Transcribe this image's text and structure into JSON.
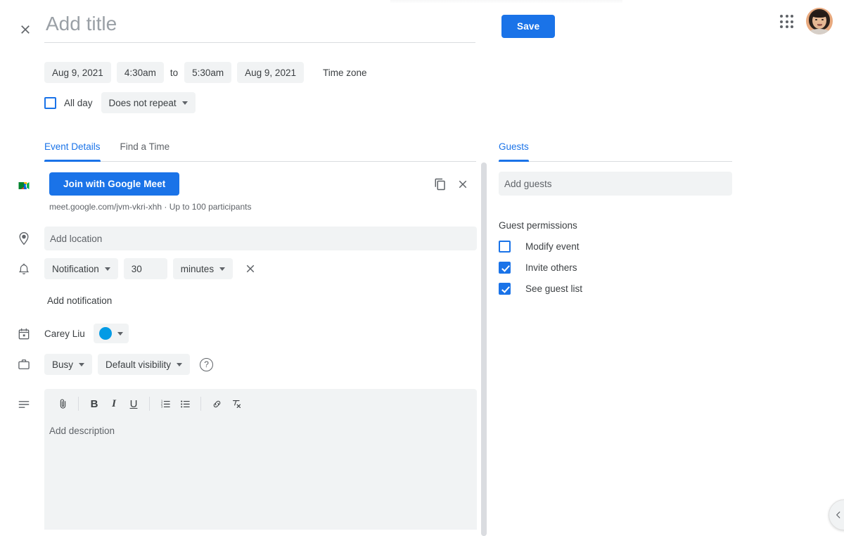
{
  "header": {
    "close_icon": "close-icon",
    "title_value": "",
    "title_placeholder": "Add title",
    "save_label": "Save",
    "apps_icon": "apps-grid-icon",
    "avatar_icon": "user-avatar"
  },
  "schedule": {
    "start_date": "Aug 9, 2021",
    "start_time": "4:30am",
    "to_label": "to",
    "end_time": "5:30am",
    "end_date": "Aug 9, 2021",
    "timezone_label": "Time zone",
    "all_day_label": "All day",
    "all_day_checked": false,
    "repeat_label": "Does not repeat"
  },
  "tabs": {
    "left": [
      {
        "label": "Event Details",
        "active": true
      },
      {
        "label": "Find a Time",
        "active": false
      }
    ],
    "right": [
      {
        "label": "Guests",
        "active": true
      }
    ]
  },
  "conference": {
    "icon": "google-meet-icon",
    "join_label": "Join with Google Meet",
    "details": "meet.google.com/jvm-vkri-xhh · Up to 100 participants",
    "copy_icon": "copy-icon",
    "remove_icon": "close-icon"
  },
  "location": {
    "icon": "location-pin-icon",
    "value": "",
    "placeholder": "Add location"
  },
  "notification": {
    "icon": "bell-icon",
    "type_label": "Notification",
    "amount_value": "30",
    "unit_label": "minutes",
    "remove_icon": "close-icon",
    "add_label": "Add notification"
  },
  "calendar": {
    "icon": "calendar-icon",
    "owner": "Carey Liu",
    "color_hex": "#039be5"
  },
  "availability": {
    "icon": "briefcase-icon",
    "busy_label": "Busy",
    "visibility_label": "Default visibility",
    "help_icon": "help-icon",
    "help_glyph": "?"
  },
  "description": {
    "icon": "description-lines-icon",
    "placeholder": "Add description",
    "toolbar": [
      {
        "name": "attach-icon",
        "label": ""
      },
      {
        "name": "bold-icon",
        "label": "B"
      },
      {
        "name": "italic-icon",
        "label": "I"
      },
      {
        "name": "underline-icon",
        "label": "U"
      },
      {
        "name": "numbered-list-icon",
        "label": ""
      },
      {
        "name": "bulleted-list-icon",
        "label": ""
      },
      {
        "name": "link-icon",
        "label": ""
      },
      {
        "name": "remove-formatting-icon",
        "label": ""
      }
    ]
  },
  "guests": {
    "input_value": "",
    "input_placeholder": "Add guests",
    "permissions_title": "Guest permissions",
    "permissions": [
      {
        "label": "Modify event",
        "checked": false
      },
      {
        "label": "Invite others",
        "checked": true
      },
      {
        "label": "See guest list",
        "checked": true
      }
    ]
  },
  "footer": {
    "collapse_icon": "chevron-left-icon"
  },
  "colors": {
    "accent": "#1a73e8",
    "chip_bg": "#f1f3f4",
    "text": "#3c4043",
    "muted": "#5f6368",
    "event_color": "#039be5"
  }
}
